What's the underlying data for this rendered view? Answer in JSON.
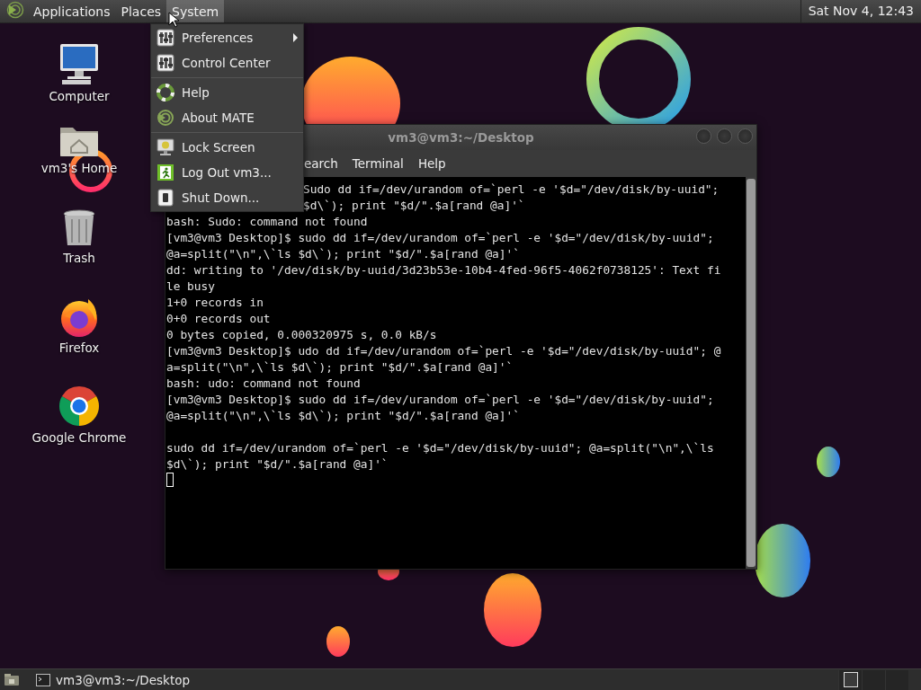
{
  "top_panel": {
    "menus": [
      {
        "label": "Applications",
        "selected": false
      },
      {
        "label": "Places",
        "selected": false
      },
      {
        "label": "System",
        "selected": true
      }
    ],
    "clock": "Sat Nov 4, 12:43"
  },
  "desktop_icons": [
    {
      "kind": "computer",
      "label": "Computer"
    },
    {
      "kind": "home",
      "label": "vm3's Home"
    },
    {
      "kind": "trash",
      "label": "Trash"
    },
    {
      "kind": "firefox",
      "label": "Firefox"
    },
    {
      "kind": "chrome",
      "label": "Google Chrome"
    }
  ],
  "system_menu": {
    "groups": [
      {
        "items": [
          {
            "kind": "prefs",
            "label": "Preferences",
            "submenu": true
          },
          {
            "kind": "control",
            "label": "Control Center",
            "submenu": false
          }
        ]
      },
      {
        "items": [
          {
            "kind": "help",
            "label": "Help",
            "submenu": false
          },
          {
            "kind": "about",
            "label": "About MATE",
            "submenu": false
          }
        ]
      },
      {
        "items": [
          {
            "kind": "lock",
            "label": "Lock Screen",
            "submenu": false
          },
          {
            "kind": "logout",
            "label": "Log Out vm3...",
            "submenu": false
          },
          {
            "kind": "shutdown",
            "label": "Shut Down...",
            "submenu": false
          }
        ]
      }
    ]
  },
  "terminal": {
    "title": "vm3@vm3:~/Desktop",
    "menus": [
      "earch",
      "Terminal",
      "Help"
    ],
    "lines": [
      {
        "kind": "partial",
        "text": "Sudo dd if=/dev/urandom of=`perl -e '$d=\"/dev/disk/by-uuid\";"
      },
      {
        "kind": "partial",
        "text": "$d\\`); print \"$d/\".$a[rand @a]'`"
      },
      {
        "kind": "text",
        "text": "bash: Sudo: command not found"
      },
      {
        "kind": "text",
        "text": "[vm3@vm3 Desktop]$ sudo dd if=/dev/urandom of=`perl -e '$d=\"/dev/disk/by-uuid\";"
      },
      {
        "kind": "text",
        "text": "@a=split(\"\\n\",\\`ls $d\\`); print \"$d/\".$a[rand @a]'`"
      },
      {
        "kind": "text",
        "text": "dd: writing to '/dev/disk/by-uuid/3d23b53e-10b4-4fed-96f5-4062f0738125': Text fi"
      },
      {
        "kind": "text",
        "text": "le busy"
      },
      {
        "kind": "text",
        "text": "1+0 records in"
      },
      {
        "kind": "text",
        "text": "0+0 records out"
      },
      {
        "kind": "text",
        "text": "0 bytes copied, 0.000320975 s, 0.0 kB/s"
      },
      {
        "kind": "text",
        "text": "[vm3@vm3 Desktop]$ udo dd if=/dev/urandom of=`perl -e '$d=\"/dev/disk/by-uuid\"; @"
      },
      {
        "kind": "text",
        "text": "a=split(\"\\n\",\\`ls $d\\`); print \"$d/\".$a[rand @a]'`"
      },
      {
        "kind": "text",
        "text": "bash: udo: command not found"
      },
      {
        "kind": "text",
        "text": "[vm3@vm3 Desktop]$ sudo dd if=/dev/urandom of=`perl -e '$d=\"/dev/disk/by-uuid\";"
      },
      {
        "kind": "text",
        "text": "@a=split(\"\\n\",\\`ls $d\\`); print \"$d/\".$a[rand @a]'`"
      },
      {
        "kind": "blank"
      },
      {
        "kind": "text",
        "text": "sudo dd if=/dev/urandom of=`perl -e '$d=\"/dev/disk/by-uuid\"; @a=split(\"\\n\",\\`ls"
      },
      {
        "kind": "text",
        "text": "$d\\`); print \"$d/\".$a[rand @a]'`"
      },
      {
        "kind": "cursor"
      }
    ]
  },
  "bottom_panel": {
    "tasks": [
      {
        "label": "vm3@vm3:~/Desktop",
        "selected": false
      }
    ]
  }
}
